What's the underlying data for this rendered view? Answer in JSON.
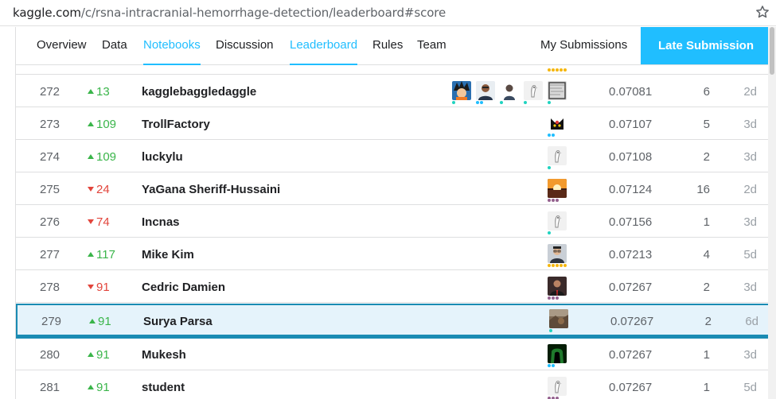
{
  "browser": {
    "url_host": "kaggle.com",
    "url_path": "/c/rsna-intracranial-hemorrhage-detection/leaderboard#score",
    "bookmark_icon": "star-outline-icon"
  },
  "tabs": [
    {
      "label": "Overview",
      "active": false
    },
    {
      "label": "Data",
      "active": false
    },
    {
      "label": "Notebooks",
      "active": true
    },
    {
      "label": "Discussion",
      "active": false
    },
    {
      "label": "Leaderboard",
      "active": true
    },
    {
      "label": "Rules",
      "active": false
    },
    {
      "label": "Team",
      "active": false
    }
  ],
  "my_submissions_label": "My Submissions",
  "late_submission_label": "Late Submission",
  "colors": {
    "accent": "#20beff",
    "up": "#3ab54a",
    "down": "#e2453c",
    "highlight_bg": "#e5f3fb",
    "highlight_border": "#1a8bb3",
    "tier_novice": "#20d3c0",
    "tier_contributor": "#20beff",
    "tier_expert": "#95628f",
    "tier_master": "#f5b70f"
  },
  "rows": [
    {
      "rank": "272",
      "direction": "up",
      "change": "13",
      "team": "kagglebaggledaggle",
      "avatars": [
        "goku-avatar",
        "man-portrait-avatar",
        "man-dark-avatar",
        "default-goose-avatar",
        "sketch-avatar"
      ],
      "tiers": [
        "novice",
        "contributor",
        "novice",
        "novice",
        "novice"
      ],
      "score": "0.07081",
      "entries": "6",
      "last": "2d",
      "me": false
    },
    {
      "rank": "273",
      "direction": "up",
      "change": "109",
      "team": "TrollFactory",
      "avatars": [
        "cat-avatar"
      ],
      "tiers": [
        "contributor"
      ],
      "score": "0.07107",
      "entries": "5",
      "last": "3d",
      "me": false
    },
    {
      "rank": "274",
      "direction": "up",
      "change": "109",
      "team": "luckylu",
      "avatars": [
        "default-goose-avatar"
      ],
      "tiers": [
        "novice"
      ],
      "score": "0.07108",
      "entries": "2",
      "last": "3d",
      "me": false
    },
    {
      "rank": "275",
      "direction": "down",
      "change": "24",
      "team": "YaGana Sheriff-Hussaini",
      "avatars": [
        "sunset-avatar"
      ],
      "tiers": [
        "expert"
      ],
      "score": "0.07124",
      "entries": "16",
      "last": "2d",
      "me": false
    },
    {
      "rank": "276",
      "direction": "down",
      "change": "74",
      "team": "Incnas",
      "avatars": [
        "default-goose-avatar"
      ],
      "tiers": [
        "novice"
      ],
      "score": "0.07156",
      "entries": "1",
      "last": "3d",
      "me": false
    },
    {
      "rank": "277",
      "direction": "up",
      "change": "117",
      "team": "Mike Kim",
      "avatars": [
        "man-glasses-avatar"
      ],
      "tiers": [
        "master"
      ],
      "score": "0.07213",
      "entries": "4",
      "last": "5d",
      "me": false
    },
    {
      "rank": "278",
      "direction": "down",
      "change": "91",
      "team": "Cedric Damien",
      "avatars": [
        "man-suit-avatar"
      ],
      "tiers": [
        "expert"
      ],
      "score": "0.07267",
      "entries": "2",
      "last": "3d",
      "me": false
    },
    {
      "rank": "279",
      "direction": "up",
      "change": "91",
      "team": "Surya Parsa",
      "avatars": [
        "landscape-avatar"
      ],
      "tiers": [
        "novice"
      ],
      "score": "0.07267",
      "entries": "2",
      "last": "6d",
      "me": true
    },
    {
      "rank": "280",
      "direction": "up",
      "change": "91",
      "team": "Mukesh",
      "avatars": [
        "hacker-avatar"
      ],
      "tiers": [
        "contributor"
      ],
      "score": "0.07267",
      "entries": "1",
      "last": "3d",
      "me": false
    },
    {
      "rank": "281",
      "direction": "up",
      "change": "91",
      "team": "student",
      "avatars": [
        "default-goose-avatar"
      ],
      "tiers": [
        "expert"
      ],
      "score": "0.07267",
      "entries": "1",
      "last": "5d",
      "me": false
    }
  ]
}
